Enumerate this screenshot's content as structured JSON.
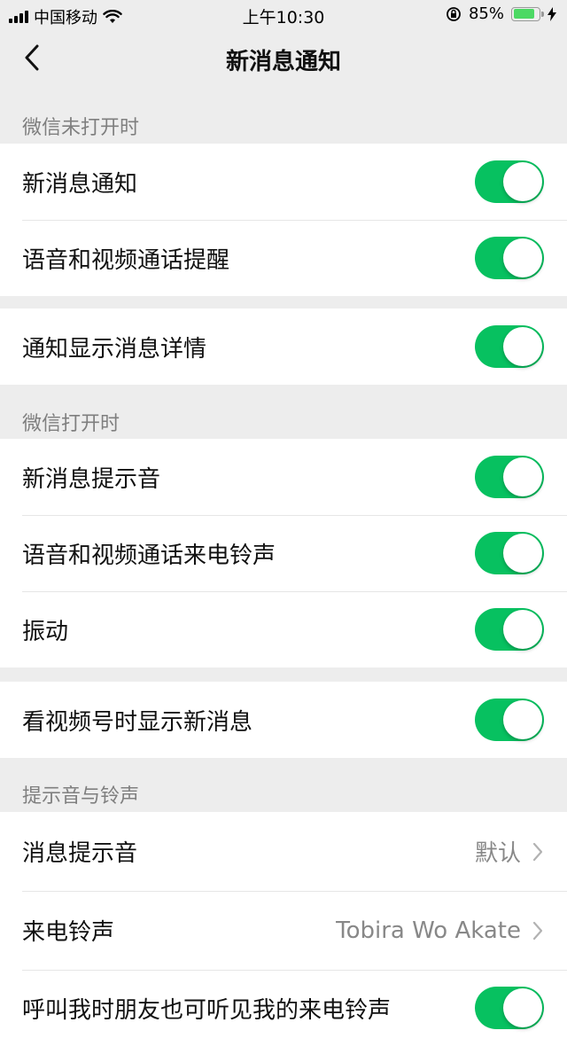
{
  "status_bar": {
    "carrier": "中国移动",
    "time": "上午10:30",
    "battery_percent": "85%",
    "battery_level": 0.85,
    "accent_color": "#4cd964"
  },
  "nav": {
    "title": "新消息通知",
    "back_icon": "chevron-left-icon"
  },
  "sections": {
    "closed_header": "微信未打开时",
    "open_header": "微信打开时",
    "sound_header": "提示音与铃声"
  },
  "rows": {
    "new_message_notify": {
      "label": "新消息通知",
      "on": true
    },
    "voice_video_alert": {
      "label": "语音和视频通话提醒",
      "on": true
    },
    "show_details": {
      "label": "通知显示消息详情",
      "on": true
    },
    "new_message_sound": {
      "label": "新消息提示音",
      "on": true
    },
    "call_ringtone_toggle": {
      "label": "语音和视频通话来电铃声",
      "on": true
    },
    "vibrate": {
      "label": "振动",
      "on": true
    },
    "channels_new_message": {
      "label": "看视频号时显示新消息",
      "on": true
    },
    "message_tone": {
      "label": "消息提示音",
      "value": "默认"
    },
    "ringtone": {
      "label": "来电铃声",
      "value": "Tobira Wo Akate"
    },
    "friends_hear_ringtone": {
      "label": "呼叫我时朋友也可听见我的来电铃声",
      "on": true
    }
  },
  "colors": {
    "toggle_on": "#07c160",
    "background": "#ededed"
  }
}
